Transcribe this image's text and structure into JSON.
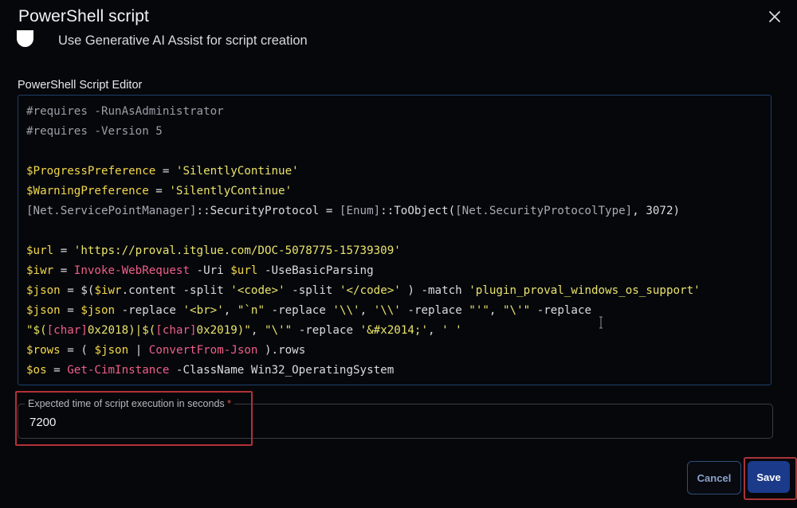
{
  "dialog": {
    "title": "PowerShell script"
  },
  "ai_toggle": {
    "label": "Use Generative AI Assist for script creation"
  },
  "editor": {
    "label": "PowerShell Script Editor",
    "lines": [
      [
        {
          "t": "#requires -RunAsAdministrator",
          "k": "comment"
        }
      ],
      [
        {
          "t": "#requires -Version 5",
          "k": "comment"
        }
      ],
      [],
      [
        {
          "t": "$ProgressPreference",
          "k": "var"
        },
        {
          "t": " = ",
          "k": "plain"
        },
        {
          "t": "'SilentlyContinue'",
          "k": "str"
        }
      ],
      [
        {
          "t": "$WarningPreference",
          "k": "var"
        },
        {
          "t": " = ",
          "k": "plain"
        },
        {
          "t": "'SilentlyContinue'",
          "k": "str"
        }
      ],
      [
        {
          "t": "[Net.ServicePointManager]",
          "k": "type"
        },
        {
          "t": "::SecurityProtocol = ",
          "k": "plain"
        },
        {
          "t": "[Enum]",
          "k": "type"
        },
        {
          "t": "::ToObject(",
          "k": "plain"
        },
        {
          "t": "[Net.SecurityProtocolType]",
          "k": "type"
        },
        {
          "t": ", 3072)",
          "k": "plain"
        }
      ],
      [],
      [
        {
          "t": "$url",
          "k": "var"
        },
        {
          "t": " = ",
          "k": "plain"
        },
        {
          "t": "'https://proval.itglue.com/DOC-5078775-15739309'",
          "k": "str"
        }
      ],
      [
        {
          "t": "$iwr",
          "k": "var"
        },
        {
          "t": " = ",
          "k": "plain"
        },
        {
          "t": "Invoke-WebRequest",
          "k": "cmd"
        },
        {
          "t": " -Uri ",
          "k": "plain"
        },
        {
          "t": "$url",
          "k": "var"
        },
        {
          "t": " -UseBasicParsing",
          "k": "plain"
        }
      ],
      [
        {
          "t": "$json",
          "k": "var"
        },
        {
          "t": " = $(",
          "k": "plain"
        },
        {
          "t": "$iwr",
          "k": "var"
        },
        {
          "t": ".content -split ",
          "k": "plain"
        },
        {
          "t": "'<code>'",
          "k": "str"
        },
        {
          "t": " -split ",
          "k": "plain"
        },
        {
          "t": "'</code>'",
          "k": "str"
        },
        {
          "t": " ) -match ",
          "k": "plain"
        },
        {
          "t": "'plugin_proval_windows_os_support'",
          "k": "str"
        }
      ],
      [
        {
          "t": "$json",
          "k": "var"
        },
        {
          "t": " = ",
          "k": "plain"
        },
        {
          "t": "$json",
          "k": "var"
        },
        {
          "t": " -replace ",
          "k": "plain"
        },
        {
          "t": "'<br>'",
          "k": "str"
        },
        {
          "t": ", ",
          "k": "plain"
        },
        {
          "t": "\"`n\"",
          "k": "str"
        },
        {
          "t": " -replace ",
          "k": "plain"
        },
        {
          "t": "'\\\\'",
          "k": "str"
        },
        {
          "t": ", ",
          "k": "plain"
        },
        {
          "t": "'\\\\'",
          "k": "str"
        },
        {
          "t": " -replace ",
          "k": "plain"
        },
        {
          "t": "\"'\"",
          "k": "str"
        },
        {
          "t": ", ",
          "k": "plain"
        },
        {
          "t": "\"\\'\"",
          "k": "str"
        },
        {
          "t": " -replace",
          "k": "plain"
        }
      ],
      [
        {
          "t": "\"$(",
          "k": "str"
        },
        {
          "t": "[char]",
          "k": "cmd"
        },
        {
          "t": "0x2018)|$(",
          "k": "str"
        },
        {
          "t": "[char]",
          "k": "cmd"
        },
        {
          "t": "0x2019)\"",
          "k": "str"
        },
        {
          "t": ", ",
          "k": "plain"
        },
        {
          "t": "\"\\'\"",
          "k": "str"
        },
        {
          "t": " -replace ",
          "k": "plain"
        },
        {
          "t": "'&#x2014;'",
          "k": "str"
        },
        {
          "t": ", ",
          "k": "plain"
        },
        {
          "t": "' '",
          "k": "str"
        }
      ],
      [
        {
          "t": "$rows",
          "k": "var"
        },
        {
          "t": " = ( ",
          "k": "plain"
        },
        {
          "t": "$json",
          "k": "var"
        },
        {
          "t": " | ",
          "k": "plain"
        },
        {
          "t": "ConvertFrom-Json",
          "k": "cmd"
        },
        {
          "t": " ).rows",
          "k": "plain"
        }
      ],
      [
        {
          "t": "$os",
          "k": "var"
        },
        {
          "t": " = ",
          "k": "plain"
        },
        {
          "t": "Get-CimInstance",
          "k": "cmd"
        },
        {
          "t": " -ClassName Win32_OperatingSystem",
          "k": "plain"
        }
      ]
    ]
  },
  "execution_time": {
    "label": "Expected time of script execution in seconds",
    "required_marker": "*",
    "value": "7200"
  },
  "footer": {
    "cancel_label": "Cancel",
    "save_label": "Save"
  },
  "colors": {
    "accent": "#1b3a8a",
    "highlight_border": "#b23137",
    "code_variable": "#f2d84a",
    "code_string": "#e9e36a",
    "code_command": "#ee5f88"
  }
}
